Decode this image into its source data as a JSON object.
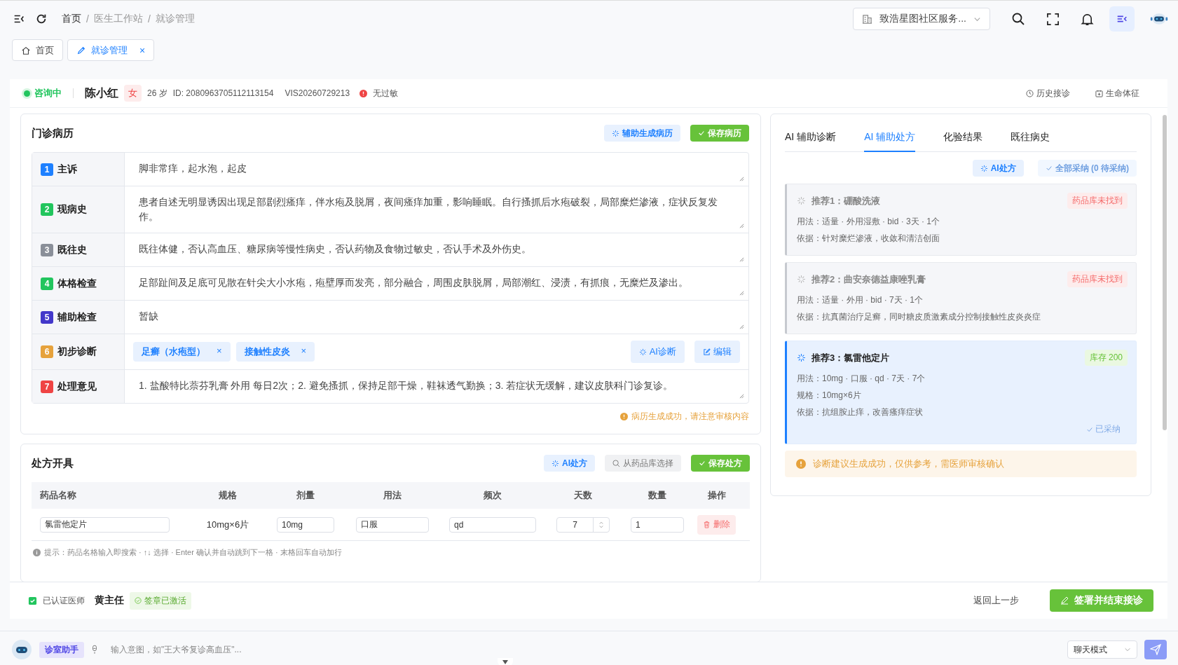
{
  "topbar": {
    "breadcrumbs": [
      "首页",
      "医生工作站",
      "就诊管理"
    ],
    "separator": "/",
    "org_selector": "致浩星图社区服务..."
  },
  "page_tabs": [
    {
      "label": "首页",
      "selected": false
    },
    {
      "label": "就诊管理",
      "selected": true,
      "close": "×"
    }
  ],
  "patient": {
    "status": "咨询中",
    "name": "陈小红",
    "gender": "女",
    "age": "26 岁",
    "id": "ID: 2080963705112113154",
    "visit": "VIS20260729213",
    "allergy": "无过敏"
  },
  "header_links": [
    "历史接诊",
    "生命体征"
  ],
  "medical_record": {
    "title": "门诊病历",
    "buttons": [
      {
        "label": "辅助生成病历",
        "kind": "soft"
      },
      {
        "label": "保存病历",
        "kind": "primary"
      }
    ],
    "fields": [
      {
        "index": "1",
        "label": "主诉",
        "color": "#1e80ff",
        "kind": "text",
        "value": "脚非常痒，起水泡，起皮"
      },
      {
        "index": "2",
        "label": "现病史",
        "color": "#22c55e",
        "kind": "text",
        "value": "患者自述无明显诱因出现足部剧烈瘙痒，伴水疱及脱屑，夜间瘙痒加重，影响睡眠。自行搔抓后水疱破裂，局部糜烂渗液，症状反复发作。"
      },
      {
        "index": "3",
        "label": "既往史",
        "color": "#8a8f99",
        "kind": "text",
        "value": "既往体健，否认高血压、糖尿病等慢性病史，否认药物及食物过敏史，否认手术及外伤史。"
      },
      {
        "index": "4",
        "label": "体格检查",
        "color": "#22c55e",
        "kind": "text",
        "value": "足部趾间及足底可见散在针尖大小水疱，疱壁厚而发亮，部分融合，周围皮肤脱屑，局部潮红、浸渍，有抓痕，无糜烂及渗出。"
      },
      {
        "index": "5",
        "label": "辅助检查",
        "color": "#4338ca",
        "kind": "text",
        "value": "暂缺"
      },
      {
        "index": "6",
        "label": "初步诊断",
        "color": "#e6a23c",
        "kind": "tags",
        "tags": [
          {
            "label": "足癣（水疱型）",
            "close": "×"
          },
          {
            "label": "接触性皮炎",
            "close": "×"
          }
        ],
        "actions": [
          "AI诊断",
          "编辑"
        ]
      },
      {
        "index": "7",
        "label": "处理意见",
        "color": "#ef4444",
        "kind": "text",
        "value": "1. 盐酸特比萘芬乳膏 外用 每日2次；2. 避免搔抓，保持足部干燥，鞋袜透气勤换；3. 若症状无缓解，建议皮肤科门诊复诊。"
      }
    ],
    "notice": "病历生成成功，请注意审核内容"
  },
  "prescription": {
    "title": "处方开具",
    "buttons": [
      {
        "label": "AI处方",
        "kind": "soft"
      },
      {
        "label": "从药品库选择",
        "kind": "plain"
      },
      {
        "label": "保存处方",
        "kind": "primary"
      }
    ],
    "columns": [
      "药品名称",
      "规格",
      "剂量",
      "用法",
      "频次",
      "天数",
      "数量",
      "操作"
    ],
    "rows": [
      {
        "drug": "氯雷他定片",
        "spec": "10mg×6片",
        "dose": "10mg",
        "route": "口服",
        "freq": "qd",
        "days": "7",
        "qty": "1",
        "action": "删除"
      }
    ],
    "hint": "提示：药品名格输入即搜索 · ↑↓ 选择 · Enter 确认并自动跳到下一格 · 末格回车自动加行"
  },
  "ai_panel": {
    "tabs": [
      {
        "label": "AI 辅助诊断",
        "selected": false
      },
      {
        "label": "AI 辅助处方",
        "selected": true
      },
      {
        "label": "化验结果",
        "selected": false
      },
      {
        "label": "既往病史",
        "selected": false
      }
    ],
    "buttons": [
      {
        "label": "AI处方",
        "disabled": false
      },
      {
        "label": "全部采纳 (0 待采纳)",
        "disabled": true
      }
    ],
    "recommendations": [
      {
        "title": "推荐1：硼酸洗液",
        "badge": "药品库未找到",
        "in_stock": false,
        "selected": false,
        "lines": [
          "用法：适量 · 外用湿敷 · bid · 3天 · 1个",
          "依据：针对糜烂渗液，收敛和清洁创面"
        ]
      },
      {
        "title": "推荐2：曲安奈德益康唑乳膏",
        "badge": "药品库未找到",
        "in_stock": false,
        "selected": false,
        "lines": [
          "用法：适量 · 外用 · bid · 7天 · 1个",
          "依据：抗真菌治疗足癣，同时糖皮质激素成分控制接触性皮炎炎症"
        ]
      },
      {
        "title": "推荐3：氯雷他定片",
        "badge": "库存 200",
        "in_stock": true,
        "selected": true,
        "lines": [
          "用法：10mg · 口服 · qd · 7天 · 7个",
          "规格：10mg×6片",
          "依据：抗组胺止痒，改善瘙痒症状"
        ],
        "adopted": "已采纳"
      }
    ],
    "notice": "诊断建议生成成功，仅供参考，需医师审核确认"
  },
  "sign_bar": {
    "verified": "已认证医师",
    "doctor": "黄主任",
    "seal": "签章已激活",
    "back": "返回上一步",
    "submit": "签署并结束接诊"
  },
  "assistant": {
    "badge": "诊室助手",
    "placeholder": "输入意图，如\"王大爷复诊高血压\"...",
    "mode": "聊天模式"
  }
}
